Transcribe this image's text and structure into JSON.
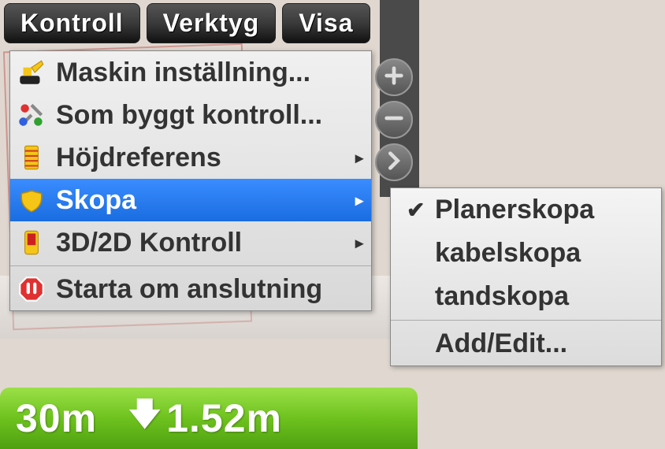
{
  "menubar": {
    "kontroll": "Kontroll",
    "verktyg": "Verktyg",
    "visa": "Visa"
  },
  "dropdown": {
    "items": [
      {
        "icon": "excavator",
        "label": "Maskin inställning...",
        "hasSubmenu": false
      },
      {
        "icon": "tools",
        "label": "Som byggt kontroll...",
        "hasSubmenu": false
      },
      {
        "icon": "height",
        "label": "Höjdreferens",
        "hasSubmenu": true
      },
      {
        "icon": "bucket",
        "label": "Skopa",
        "hasSubmenu": true,
        "selected": true
      },
      {
        "icon": "device",
        "label": "3D/2D Kontroll",
        "hasSubmenu": true
      },
      {
        "icon": "stop",
        "label": "Starta om anslutning",
        "hasSubmenu": false
      }
    ]
  },
  "submenu": {
    "items": [
      {
        "label": "Planerskopa",
        "checked": true
      },
      {
        "label": "kabelskopa",
        "checked": false
      },
      {
        "label": "tandskopa",
        "checked": false
      }
    ],
    "add_edit": "Add/Edit..."
  },
  "round_icons": {
    "plus": "plus",
    "minus": "minus",
    "forward": "forward"
  },
  "status": {
    "val1": "30m",
    "val2": "1.52m"
  }
}
